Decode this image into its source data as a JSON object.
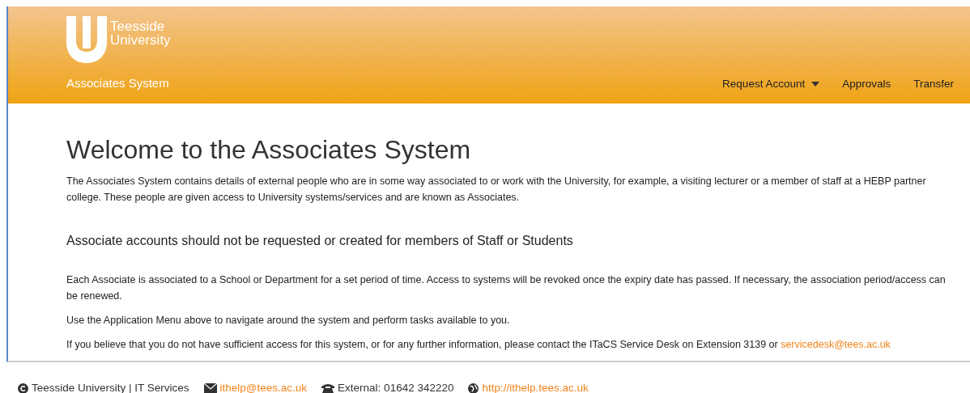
{
  "header": {
    "logo_text": [
      "Teesside",
      "University"
    ],
    "system_name": "Associates System",
    "nav": [
      {
        "label": "Request Account",
        "dropdown": true
      },
      {
        "label": "Approvals",
        "dropdown": false
      },
      {
        "label": "Transfer",
        "dropdown": false
      }
    ]
  },
  "main": {
    "title": "Welcome to the Associates System",
    "intro": "The Associates System contains details of external people who are in some way associated to or work with the University, for example, a visiting lecturer or a member of staff at a HEBP partner college. These people are given access to University systems/services and are known as Associates.",
    "notice": "Associate accounts should not be requested or created for members of Staff or Students",
    "paragraphs": [
      {
        "text": "Each Associate is associated to a School or Department for a set period of time. Access to systems will be revoked once the expiry date has passed. If necessary, the association period/access can be renewed."
      },
      {
        "text": "Use the Application Menu above to navigate around the system and perform tasks available to you."
      },
      {
        "text": "If you believe that you do not have sufficient access for this system, or for any further information, please contact the ITaCS Service Desk on Extension 3139 or ",
        "link": "servicedesk@tees.ac.uk"
      }
    ]
  },
  "footer": [
    {
      "kind": "copyright",
      "text": "Teesside University | IT Services"
    },
    {
      "kind": "email",
      "link": "ithelp@tees.ac.uk"
    },
    {
      "kind": "phone",
      "text": "External: 01642 342220"
    },
    {
      "kind": "web",
      "link": "http://ithelp.tees.ac.uk"
    }
  ]
}
